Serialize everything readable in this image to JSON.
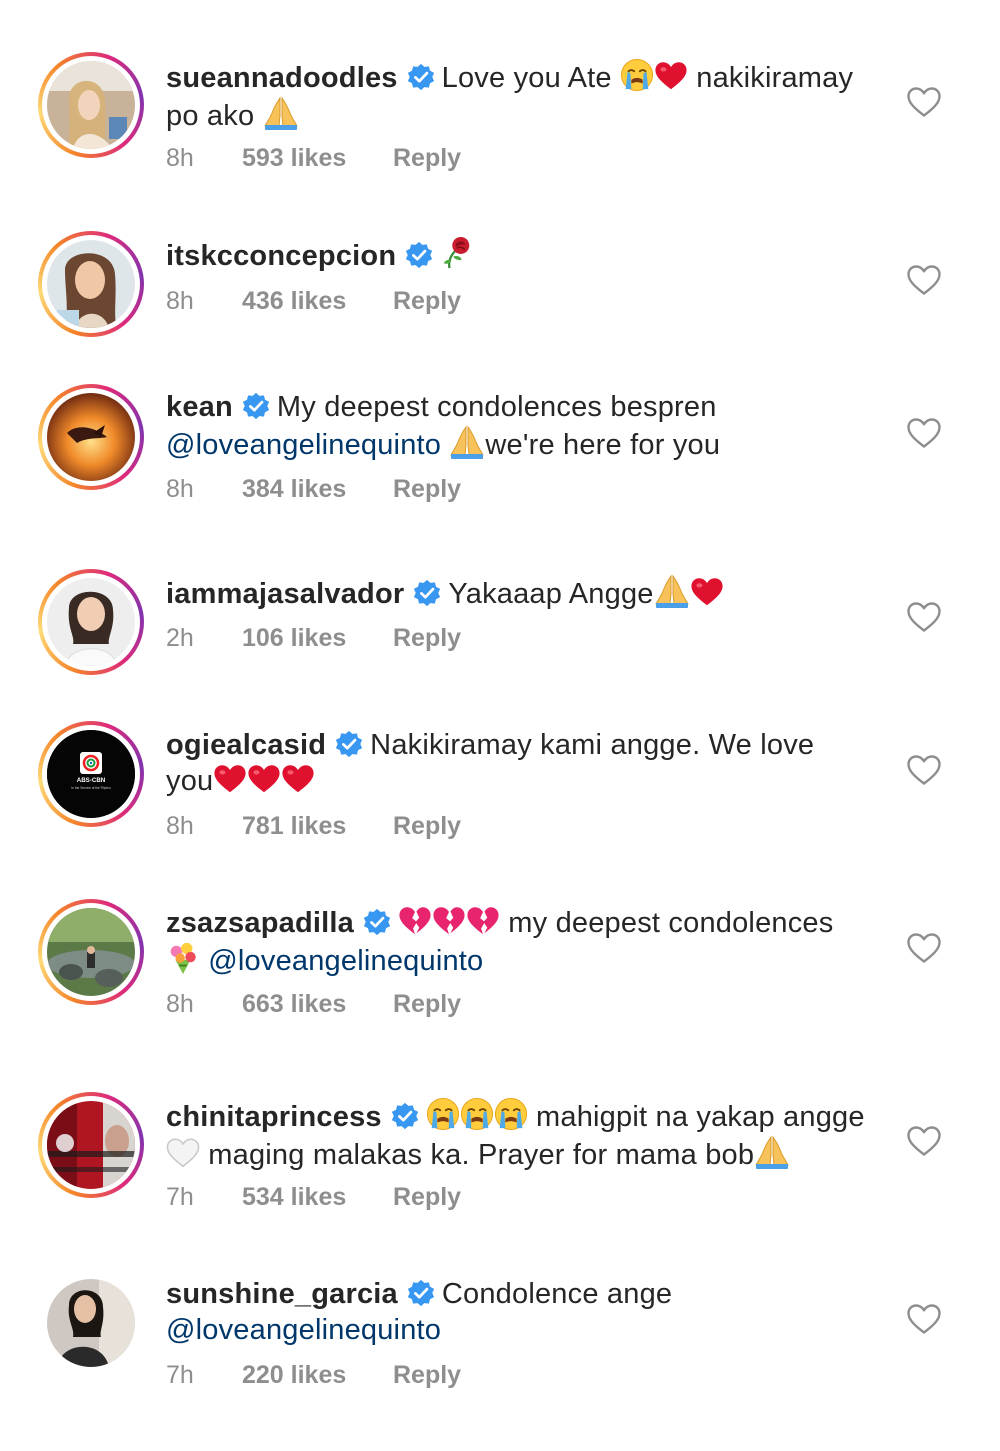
{
  "comments": [
    {
      "username": "sueannadoodles",
      "text_before": "Love you Ate",
      "text_after": "nakikiramay",
      "line2": "po ako",
      "time": "8h",
      "likes": "593 likes",
      "reply": "Reply"
    },
    {
      "username": "itskcconcepcion",
      "time": "8h",
      "likes": "436 likes",
      "reply": "Reply"
    },
    {
      "username": "kean",
      "text": "My deepest condolences bespren",
      "mention": "@loveangelinequinto",
      "text_after": "we're here for you",
      "time": "8h",
      "likes": "384 likes",
      "reply": "Reply"
    },
    {
      "username": "iammajasalvador",
      "text": "Yakaaap Angge",
      "time": "2h",
      "likes": "106 likes",
      "reply": "Reply"
    },
    {
      "username": "ogiealcasid",
      "text": "Nakikiramay kami angge. We love",
      "line2": "you",
      "avatar_text": "ABS-CBN",
      "avatar_subtext": "In the Service of the Filipino",
      "time": "8h",
      "likes": "781 likes",
      "reply": "Reply"
    },
    {
      "username": "zsazsapadilla",
      "text": "my deepest condolences",
      "mention": "@loveangelinequinto",
      "time": "8h",
      "likes": "663 likes",
      "reply": "Reply"
    },
    {
      "username": "chinitaprincess",
      "text": "mahigpit na yakap angge",
      "line2": "maging malakas ka. Prayer for mama bob",
      "time": "7h",
      "likes": "534 likes",
      "reply": "Reply"
    },
    {
      "username": "sunshine_garcia",
      "text": "Condolence ange",
      "mention": "@loveangelinequinto",
      "time": "7h",
      "likes": "220 likes",
      "reply": "Reply"
    }
  ],
  "icons": {
    "verified": "verified-badge-icon",
    "like": "heart-outline-icon"
  },
  "colors": {
    "verified": "#3897f0",
    "username": "#262626",
    "meta": "#8e8e8e",
    "mention": "#00376b"
  }
}
